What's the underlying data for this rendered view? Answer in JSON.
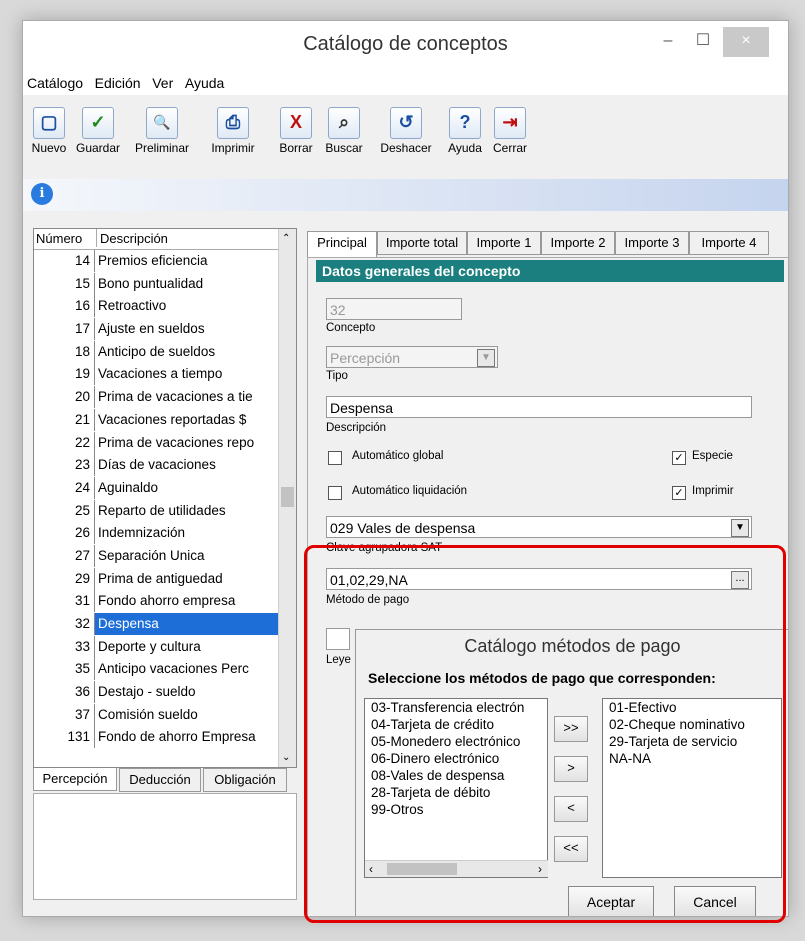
{
  "window": {
    "title": "Catálogo de conceptos",
    "minimize": "–",
    "maximize": "☐",
    "close": "×"
  },
  "menu": [
    "Catálogo",
    "Edición",
    "Ver",
    "Ayuda"
  ],
  "toolbar": [
    {
      "label": "Nuevo",
      "icon": "new-doc-icon",
      "glyph": "▢"
    },
    {
      "label": "Guardar",
      "icon": "checkmark-icon",
      "glyph": "✓"
    },
    {
      "label": "Preliminar",
      "icon": "preview-icon",
      "glyph": "🔍"
    },
    {
      "label": "Imprimir",
      "icon": "printer-icon",
      "glyph": "⎙"
    },
    {
      "label": "Borrar",
      "icon": "delete-icon",
      "glyph": "X"
    },
    {
      "label": "Buscar",
      "icon": "binoculars-icon",
      "glyph": "⌕"
    },
    {
      "label": "Deshacer",
      "icon": "undo-icon",
      "glyph": "↺"
    },
    {
      "label": "Ayuda",
      "icon": "help-icon",
      "glyph": "?"
    },
    {
      "label": "Cerrar",
      "icon": "exit-icon",
      "glyph": "⇥"
    }
  ],
  "list": {
    "headers": [
      "Número",
      "Descripción"
    ],
    "rows": [
      {
        "num": "14",
        "desc": "Premios eficiencia"
      },
      {
        "num": "15",
        "desc": "Bono puntualidad"
      },
      {
        "num": "16",
        "desc": "Retroactivo"
      },
      {
        "num": "17",
        "desc": "Ajuste en sueldos"
      },
      {
        "num": "18",
        "desc": "Anticipo de sueldos"
      },
      {
        "num": "19",
        "desc": "Vacaciones a tiempo"
      },
      {
        "num": "20",
        "desc": "Prima de vacaciones a tie"
      },
      {
        "num": "21",
        "desc": "Vacaciones reportadas $"
      },
      {
        "num": "22",
        "desc": "Prima de vacaciones repo"
      },
      {
        "num": "23",
        "desc": "Días de vacaciones"
      },
      {
        "num": "24",
        "desc": "Aguinaldo"
      },
      {
        "num": "25",
        "desc": "Reparto de utilidades"
      },
      {
        "num": "26",
        "desc": "Indemnización"
      },
      {
        "num": "27",
        "desc": "Separación Unica"
      },
      {
        "num": "29",
        "desc": "Prima de antiguedad"
      },
      {
        "num": "31",
        "desc": "Fondo ahorro empresa"
      },
      {
        "num": "32",
        "desc": "Despensa",
        "selected": true
      },
      {
        "num": "33",
        "desc": "Deporte y cultura"
      },
      {
        "num": "35",
        "desc": "Anticipo vacaciones Perc"
      },
      {
        "num": "36",
        "desc": "Destajo - sueldo"
      },
      {
        "num": "37",
        "desc": "Comisión sueldo"
      },
      {
        "num": "131",
        "desc": "Fondo de ahorro Empresa"
      }
    ],
    "tabs": [
      "Percepción",
      "Deducción",
      "Obligación"
    ]
  },
  "tabs": [
    "Principal",
    "Importe total",
    "Importe 1",
    "Importe 2",
    "Importe 3",
    "Importe 4"
  ],
  "form": {
    "section": "Datos generales del concepto",
    "concepto_value": "32",
    "concepto_label": "Concepto",
    "tipo_value": "Percepción",
    "tipo_label": "Tipo",
    "descripcion_value": "Despensa",
    "descripcion_label": "Descripción",
    "auto_global": "Automático global",
    "especie": "Especie",
    "auto_liq": "Automático liquidación",
    "imprimir": "Imprimir",
    "clave_value": "029  Vales de despensa",
    "clave_label": "Clave agrupadora SAT",
    "metodo_value": "01,02,29,NA",
    "metodo_label": "Método de pago",
    "ellipsis": "...",
    "leyenda_label": "Leye"
  },
  "dialog": {
    "title": "Catálogo métodos de pago",
    "prompt": "Seleccione los métodos de pago que corresponden:",
    "available": [
      "03-Transferencia electrón",
      "04-Tarjeta de crédito",
      "05-Monedero electrónico",
      "06-Dinero electrónico",
      "08-Vales de despensa",
      "28-Tarjeta de débito",
      "99-Otros"
    ],
    "selected": [
      "01-Efectivo",
      "02-Cheque nominativo",
      "29-Tarjeta de servicio",
      "NA-NA"
    ],
    "buttons": [
      ">>",
      ">",
      "<",
      "<<"
    ],
    "ok": "Aceptar",
    "cancel": "Cancel"
  }
}
